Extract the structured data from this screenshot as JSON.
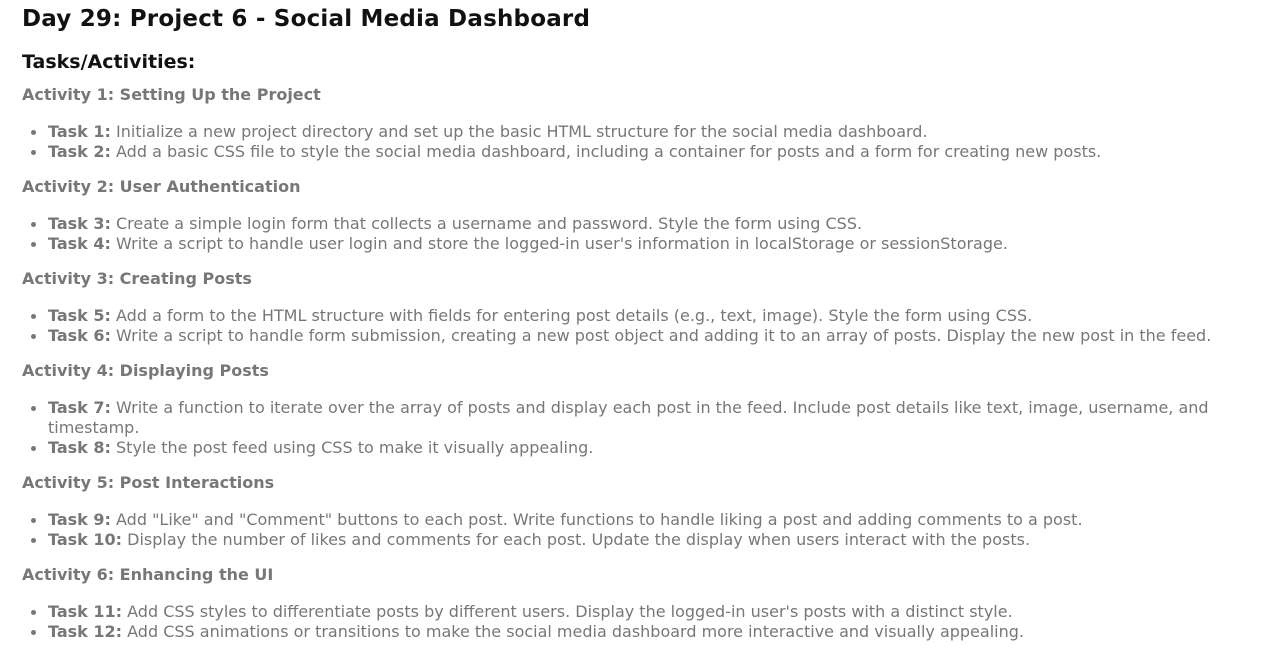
{
  "header": {
    "title": "Day 29: Project 6 - Social Media Dashboard",
    "subtitle": "Tasks/Activities:"
  },
  "activities": [
    {
      "heading": "Activity 1: Setting Up the Project",
      "tasks": [
        {
          "label": "Task 1:",
          "text": " Initialize a new project directory and set up the basic HTML structure for the social media dashboard."
        },
        {
          "label": "Task 2:",
          "text": " Add a basic CSS file to style the social media dashboard, including a container for posts and a form for creating new posts."
        }
      ]
    },
    {
      "heading": "Activity 2: User Authentication",
      "tasks": [
        {
          "label": "Task 3:",
          "text": " Create a simple login form that collects a username and password. Style the form using CSS."
        },
        {
          "label": "Task 4:",
          "text": " Write a script to handle user login and store the logged-in user's information in localStorage or sessionStorage."
        }
      ]
    },
    {
      "heading": "Activity 3: Creating Posts",
      "tasks": [
        {
          "label": "Task 5:",
          "text": " Add a form to the HTML structure with fields for entering post details (e.g., text, image). Style the form using CSS."
        },
        {
          "label": "Task 6:",
          "text": " Write a script to handle form submission, creating a new post object and adding it to an array of posts. Display the new post in the feed."
        }
      ]
    },
    {
      "heading": "Activity 4: Displaying Posts",
      "tasks": [
        {
          "label": "Task 7:",
          "text": " Write a function to iterate over the array of posts and display each post in the feed. Include post details like text, image, username, and timestamp."
        },
        {
          "label": "Task 8:",
          "text": " Style the post feed using CSS to make it visually appealing."
        }
      ]
    },
    {
      "heading": "Activity 5: Post Interactions",
      "tasks": [
        {
          "label": "Task 9:",
          "text": " Add \"Like\" and \"Comment\" buttons to each post. Write functions to handle liking a post and adding comments to a post."
        },
        {
          "label": "Task 10:",
          "text": " Display the number of likes and comments for each post. Update the display when users interact with the posts."
        }
      ]
    },
    {
      "heading": "Activity 6: Enhancing the UI",
      "tasks": [
        {
          "label": "Task 11:",
          "text": " Add CSS styles to differentiate posts by different users. Display the logged-in user's posts with a distinct style."
        },
        {
          "label": "Task 12:",
          "text": " Add CSS animations or transitions to make the social media dashboard more interactive and visually appealing."
        }
      ]
    }
  ]
}
